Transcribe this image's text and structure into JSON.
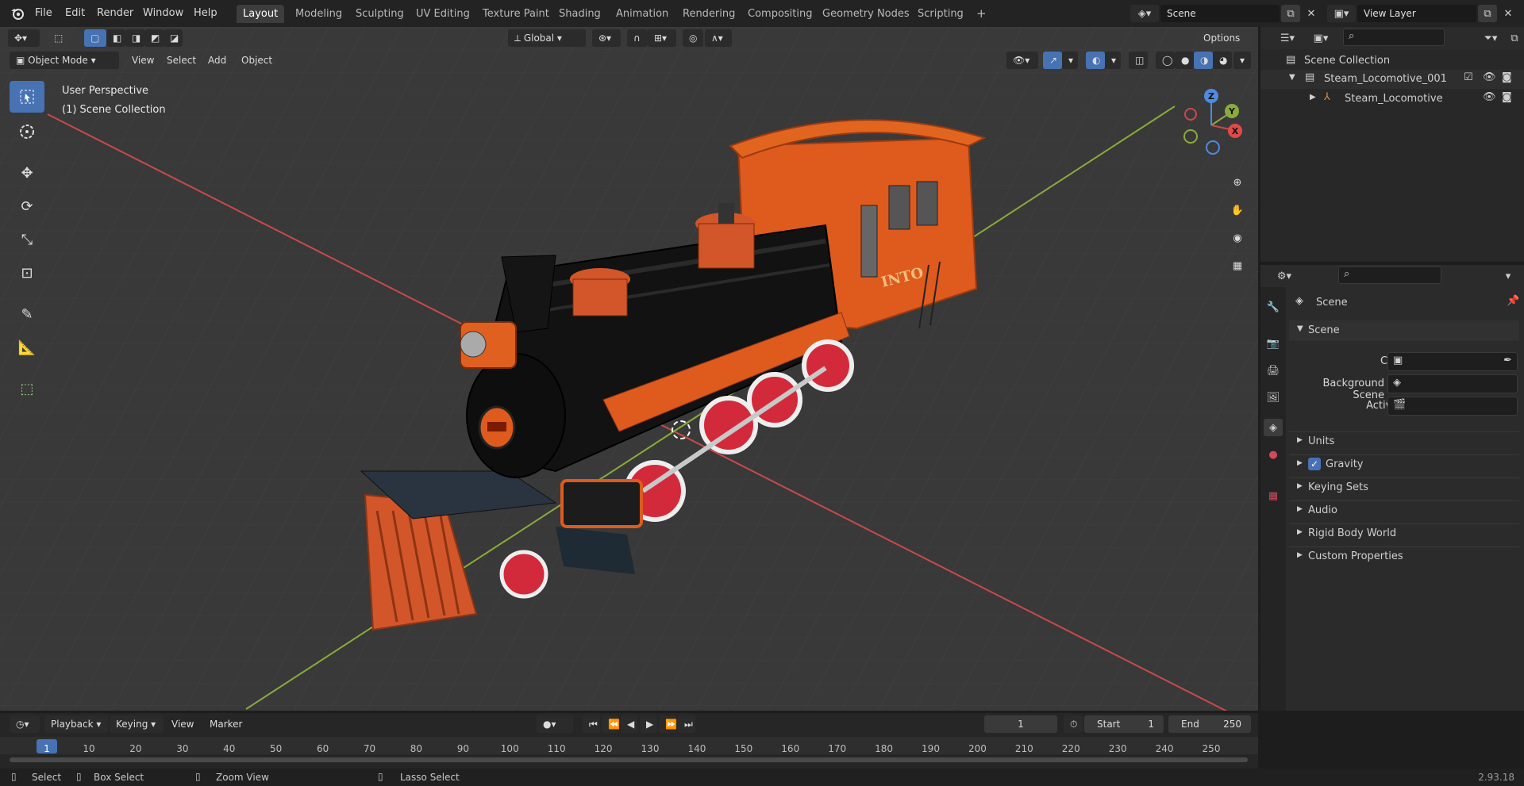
{
  "menu": [
    "File",
    "Edit",
    "Render",
    "Window",
    "Help"
  ],
  "workspaces": [
    "Layout",
    "Modeling",
    "Sculpting",
    "UV Editing",
    "Texture Paint",
    "Shading",
    "Animation",
    "Rendering",
    "Compositing",
    "Geometry Nodes",
    "Scripting"
  ],
  "active_workspace": "Layout",
  "scene_field": "Scene",
  "view_layer_field": "View Layer",
  "viewport": {
    "mode": "Object Mode",
    "menus": [
      "View",
      "Select",
      "Add",
      "Object"
    ],
    "transform_orientation": "Global",
    "options_label": "Options",
    "perspective": "User Perspective",
    "collection": "(1) Scene Collection",
    "axis_labels": {
      "z": "Z",
      "y": "Y",
      "x": "X"
    },
    "tender_lettering": "INTO"
  },
  "outliner": {
    "root": "Scene Collection",
    "items": [
      {
        "label": "Steam_Locomotive_001",
        "level": 1
      },
      {
        "label": "Steam_Locomotive",
        "level": 2
      }
    ]
  },
  "properties": {
    "context": "Scene",
    "section": "Scene",
    "fields": [
      {
        "label": "Camera"
      },
      {
        "label": "Background Scene"
      },
      {
        "label": "Active Clip"
      }
    ],
    "panels": [
      "Units",
      "Gravity",
      "Keying Sets",
      "Audio",
      "Rigid Body World",
      "Custom Properties"
    ],
    "gravity_checked": true
  },
  "timeline": {
    "menus": [
      "Playback",
      "Keying",
      "View",
      "Marker"
    ],
    "current_frame": "1",
    "start_label": "Start",
    "start": "1",
    "end_label": "End",
    "end": "250",
    "ticks": [
      "1",
      "10",
      "20",
      "30",
      "40",
      "50",
      "60",
      "70",
      "80",
      "90",
      "100",
      "110",
      "120",
      "130",
      "140",
      "150",
      "160",
      "170",
      "180",
      "190",
      "200",
      "210",
      "220",
      "230",
      "240",
      "250"
    ]
  },
  "status": {
    "select": "Select",
    "box_select": "Box Select",
    "zoom_view": "Zoom View",
    "lasso_select": "Lasso Select",
    "version": "2.93.18"
  },
  "colors": {
    "accent": "#4772b3",
    "axis_x": "#c94a4a",
    "axis_y": "#8aab3c",
    "locomotive_orange": "#e05a1c",
    "viewport_bg": "#3a3a3a"
  }
}
